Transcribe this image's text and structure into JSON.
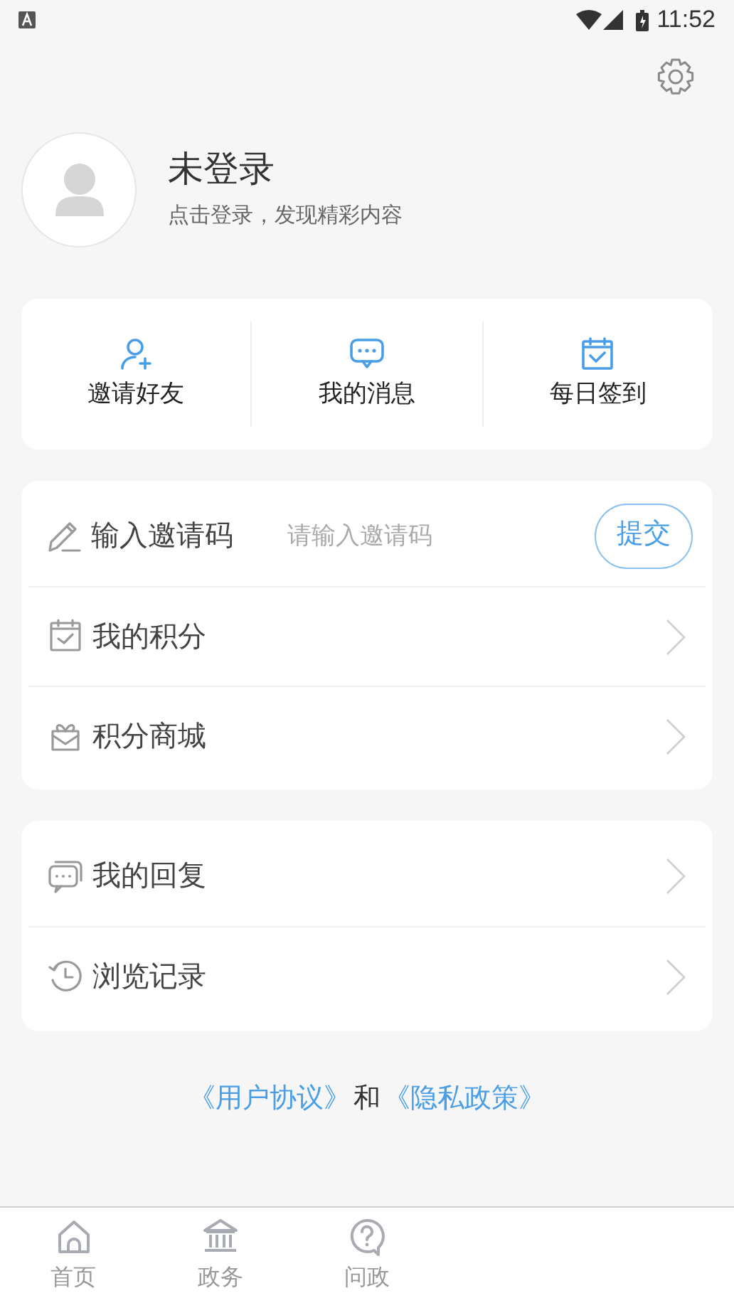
{
  "status_bar": {
    "time": "11:52"
  },
  "profile": {
    "name": "未登录",
    "subtitle": "点击登录，发现精彩内容"
  },
  "quick_actions": [
    {
      "kind": "invite",
      "label": "邀请好友"
    },
    {
      "kind": "message",
      "label": "我的消息"
    },
    {
      "kind": "checkin",
      "label": "每日签到"
    }
  ],
  "invite_code": {
    "label": "输入邀请码",
    "placeholder": "请输入邀请码",
    "button": "提交"
  },
  "menu_group_1": [
    {
      "kind": "points",
      "label": "我的积分"
    },
    {
      "kind": "mall",
      "label": "积分商城"
    }
  ],
  "menu_group_2": [
    {
      "kind": "reply",
      "label": "我的回复"
    },
    {
      "kind": "history",
      "label": "浏览记录"
    }
  ],
  "agreement": {
    "user_agreement": "《用户协议》",
    "conjunction": "和",
    "privacy_policy": "《隐私政策》"
  },
  "bottom_nav": [
    {
      "kind": "home",
      "label": "首页",
      "selected": false
    },
    {
      "kind": "gov",
      "label": "政务",
      "selected": false
    },
    {
      "kind": "ask",
      "label": "问政",
      "selected": false
    }
  ]
}
